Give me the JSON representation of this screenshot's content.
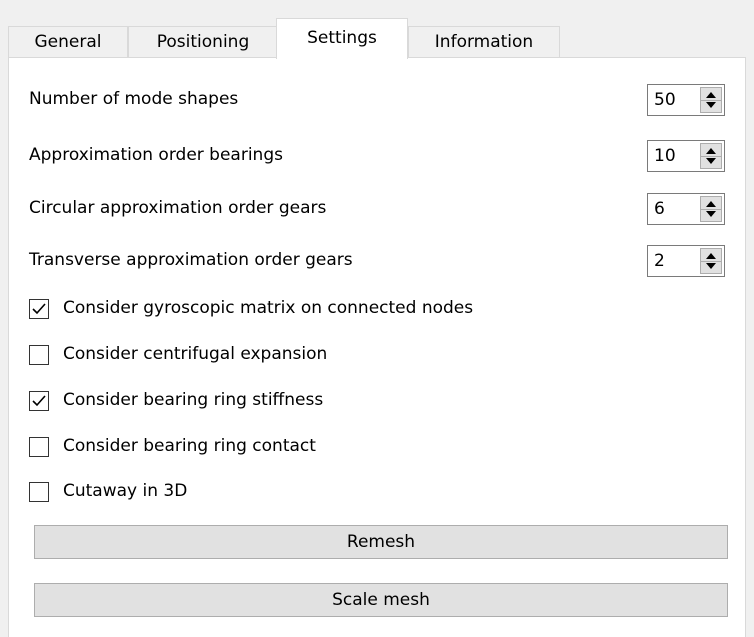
{
  "tabs": [
    {
      "label": "General",
      "active": false
    },
    {
      "label": "Positioning",
      "active": false
    },
    {
      "label": "Settings",
      "active": true
    },
    {
      "label": "Information",
      "active": false
    }
  ],
  "fields": [
    {
      "label": "Number of mode shapes",
      "value": "50"
    },
    {
      "label": "Approximation order bearings",
      "value": "10"
    },
    {
      "label": "Circular approximation order gears",
      "value": "6"
    },
    {
      "label": "Transverse approximation order gears",
      "value": "2"
    }
  ],
  "checkboxes": [
    {
      "label": "Consider gyroscopic matrix on connected nodes",
      "checked": true
    },
    {
      "label": "Consider centrifugal expansion",
      "checked": false
    },
    {
      "label": "Consider bearing ring stiffness",
      "checked": true
    },
    {
      "label": "Consider bearing ring contact",
      "checked": false
    },
    {
      "label": "Cutaway in 3D",
      "checked": false
    }
  ],
  "buttons": {
    "remesh_label": "Remesh",
    "scale_mesh_label": "Scale mesh"
  },
  "colors": {
    "panel_bg": "#ffffff",
    "window_bg": "#f0f0f0",
    "button_bg": "#e1e1e1"
  }
}
